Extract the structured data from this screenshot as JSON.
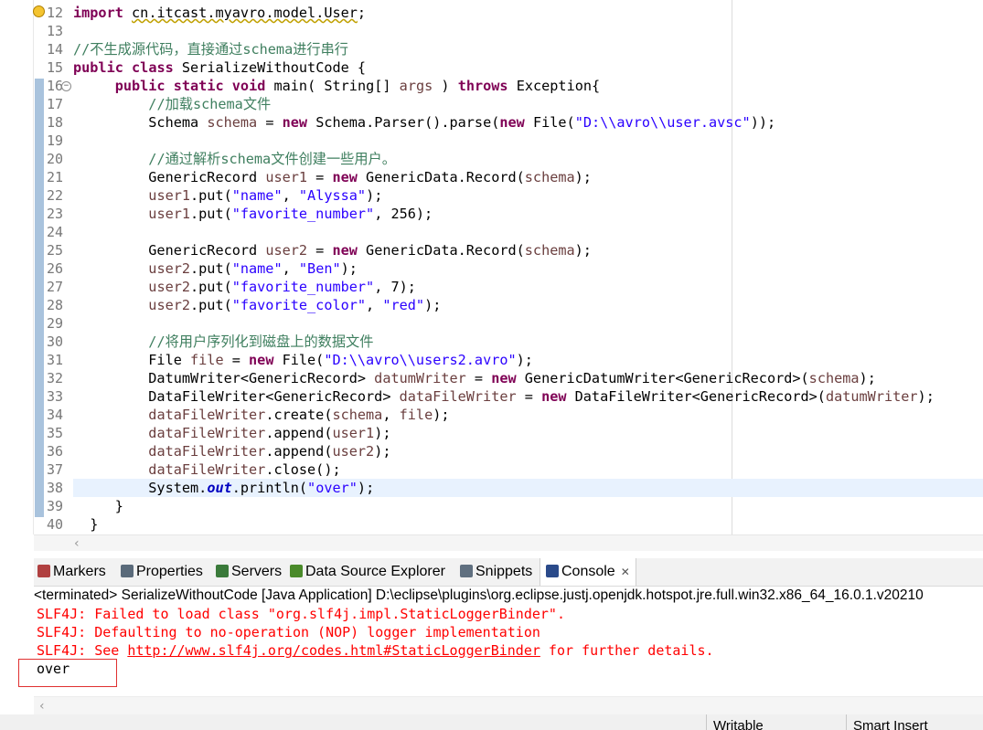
{
  "editor": {
    "lines": [
      {
        "n": "12",
        "parts": [
          {
            "t": "import",
            "c": "kw"
          },
          {
            "t": " "
          },
          {
            "t": "cn.itcast.myavro.model.User",
            "c": "imp"
          },
          {
            "t": ";"
          }
        ]
      },
      {
        "n": "13",
        "parts": []
      },
      {
        "n": "14",
        "parts": [
          {
            "t": "//不生成源代码，直接通过schema进行串行",
            "c": "cmt"
          }
        ]
      },
      {
        "n": "15",
        "parts": [
          {
            "t": "public",
            "c": "kw"
          },
          {
            "t": " "
          },
          {
            "t": "class",
            "c": "kw"
          },
          {
            "t": " SerializeWithoutCode {"
          }
        ]
      },
      {
        "n": "16",
        "parts": [
          {
            "t": "     "
          },
          {
            "t": "public",
            "c": "kw"
          },
          {
            "t": " "
          },
          {
            "t": "static",
            "c": "kw"
          },
          {
            "t": " "
          },
          {
            "t": "void",
            "c": "kw"
          },
          {
            "t": " main( String[] "
          },
          {
            "t": "args",
            "c": "var"
          },
          {
            "t": " ) "
          },
          {
            "t": "throws",
            "c": "kw"
          },
          {
            "t": " Exception{"
          }
        ]
      },
      {
        "n": "17",
        "parts": [
          {
            "t": "         "
          },
          {
            "t": "//加载schema文件",
            "c": "cmt"
          }
        ]
      },
      {
        "n": "18",
        "parts": [
          {
            "t": "         Schema "
          },
          {
            "t": "schema",
            "c": "var"
          },
          {
            "t": " = "
          },
          {
            "t": "new",
            "c": "kw"
          },
          {
            "t": " Schema.Parser().parse("
          },
          {
            "t": "new",
            "c": "kw"
          },
          {
            "t": " File("
          },
          {
            "t": "\"D:\\\\avro\\\\user.avsc\"",
            "c": "str"
          },
          {
            "t": "));"
          }
        ]
      },
      {
        "n": "19",
        "parts": []
      },
      {
        "n": "20",
        "parts": [
          {
            "t": "         "
          },
          {
            "t": "//通过解析schema文件创建一些用户。",
            "c": "cmt"
          }
        ]
      },
      {
        "n": "21",
        "parts": [
          {
            "t": "         GenericRecord "
          },
          {
            "t": "user1",
            "c": "var"
          },
          {
            "t": " = "
          },
          {
            "t": "new",
            "c": "kw"
          },
          {
            "t": " GenericData.Record("
          },
          {
            "t": "schema",
            "c": "var"
          },
          {
            "t": ");"
          }
        ]
      },
      {
        "n": "22",
        "parts": [
          {
            "t": "         "
          },
          {
            "t": "user1",
            "c": "var"
          },
          {
            "t": ".put("
          },
          {
            "t": "\"name\"",
            "c": "str"
          },
          {
            "t": ", "
          },
          {
            "t": "\"Alyssa\"",
            "c": "str"
          },
          {
            "t": ");"
          }
        ]
      },
      {
        "n": "23",
        "parts": [
          {
            "t": "         "
          },
          {
            "t": "user1",
            "c": "var"
          },
          {
            "t": ".put("
          },
          {
            "t": "\"favorite_number\"",
            "c": "str"
          },
          {
            "t": ", 256);"
          }
        ]
      },
      {
        "n": "24",
        "parts": []
      },
      {
        "n": "25",
        "parts": [
          {
            "t": "         GenericRecord "
          },
          {
            "t": "user2",
            "c": "var"
          },
          {
            "t": " = "
          },
          {
            "t": "new",
            "c": "kw"
          },
          {
            "t": " GenericData.Record("
          },
          {
            "t": "schema",
            "c": "var"
          },
          {
            "t": ");"
          }
        ]
      },
      {
        "n": "26",
        "parts": [
          {
            "t": "         "
          },
          {
            "t": "user2",
            "c": "var"
          },
          {
            "t": ".put("
          },
          {
            "t": "\"name\"",
            "c": "str"
          },
          {
            "t": ", "
          },
          {
            "t": "\"Ben\"",
            "c": "str"
          },
          {
            "t": ");"
          }
        ]
      },
      {
        "n": "27",
        "parts": [
          {
            "t": "         "
          },
          {
            "t": "user2",
            "c": "var"
          },
          {
            "t": ".put("
          },
          {
            "t": "\"favorite_number\"",
            "c": "str"
          },
          {
            "t": ", 7);"
          }
        ]
      },
      {
        "n": "28",
        "parts": [
          {
            "t": "         "
          },
          {
            "t": "user2",
            "c": "var"
          },
          {
            "t": ".put("
          },
          {
            "t": "\"favorite_color\"",
            "c": "str"
          },
          {
            "t": ", "
          },
          {
            "t": "\"red\"",
            "c": "str"
          },
          {
            "t": ");"
          }
        ]
      },
      {
        "n": "29",
        "parts": []
      },
      {
        "n": "30",
        "parts": [
          {
            "t": "         "
          },
          {
            "t": "//将用户序列化到磁盘上的数据文件",
            "c": "cmt"
          }
        ]
      },
      {
        "n": "31",
        "parts": [
          {
            "t": "         File "
          },
          {
            "t": "file",
            "c": "var"
          },
          {
            "t": " = "
          },
          {
            "t": "new",
            "c": "kw"
          },
          {
            "t": " File("
          },
          {
            "t": "\"D:\\\\avro\\\\users2.avro\"",
            "c": "str"
          },
          {
            "t": ");"
          }
        ]
      },
      {
        "n": "32",
        "parts": [
          {
            "t": "         DatumWriter<GenericRecord> "
          },
          {
            "t": "datumWriter",
            "c": "var"
          },
          {
            "t": " = "
          },
          {
            "t": "new",
            "c": "kw"
          },
          {
            "t": " GenericDatumWriter<GenericRecord>("
          },
          {
            "t": "schema",
            "c": "var"
          },
          {
            "t": ");"
          }
        ]
      },
      {
        "n": "33",
        "parts": [
          {
            "t": "         DataFileWriter<GenericRecord> "
          },
          {
            "t": "dataFileWriter",
            "c": "var"
          },
          {
            "t": " = "
          },
          {
            "t": "new",
            "c": "kw"
          },
          {
            "t": " DataFileWriter<GenericRecord>("
          },
          {
            "t": "datumWriter",
            "c": "var"
          },
          {
            "t": ");"
          }
        ]
      },
      {
        "n": "34",
        "parts": [
          {
            "t": "         "
          },
          {
            "t": "dataFileWriter",
            "c": "var"
          },
          {
            "t": ".create("
          },
          {
            "t": "schema",
            "c": "var"
          },
          {
            "t": ", "
          },
          {
            "t": "file",
            "c": "var"
          },
          {
            "t": ");"
          }
        ]
      },
      {
        "n": "35",
        "parts": [
          {
            "t": "         "
          },
          {
            "t": "dataFileWriter",
            "c": "var"
          },
          {
            "t": ".append("
          },
          {
            "t": "user1",
            "c": "var"
          },
          {
            "t": ");"
          }
        ]
      },
      {
        "n": "36",
        "parts": [
          {
            "t": "         "
          },
          {
            "t": "dataFileWriter",
            "c": "var"
          },
          {
            "t": ".append("
          },
          {
            "t": "user2",
            "c": "var"
          },
          {
            "t": ");"
          }
        ]
      },
      {
        "n": "37",
        "parts": [
          {
            "t": "         "
          },
          {
            "t": "dataFileWriter",
            "c": "var"
          },
          {
            "t": ".close();"
          }
        ]
      },
      {
        "n": "38",
        "current": true,
        "parts": [
          {
            "t": "         System."
          },
          {
            "t": "out",
            "c": "fld"
          },
          {
            "t": ".println("
          },
          {
            "t": "\"over\"",
            "c": "str"
          },
          {
            "t": ");"
          }
        ]
      },
      {
        "n": "39",
        "parts": [
          {
            "t": "     }"
          }
        ]
      },
      {
        "n": "40",
        "parts": [
          {
            "t": "  }"
          }
        ]
      }
    ]
  },
  "tabs": [
    {
      "label": "Markers",
      "icon": "markers-icon",
      "color": "#b04040"
    },
    {
      "label": "Properties",
      "icon": "properties-icon",
      "color": "#5a6a7a"
    },
    {
      "label": "Servers",
      "icon": "servers-icon",
      "color": "#3a7a3a"
    },
    {
      "label": "Data Source Explorer",
      "icon": "data-source-icon",
      "color": "#4a8a2a"
    },
    {
      "label": "Snippets",
      "icon": "snippets-icon",
      "color": "#607080"
    },
    {
      "label": "Console",
      "icon": "console-icon",
      "color": "#2a4a8a",
      "active": true
    }
  ],
  "console": {
    "header": "<terminated> SerializeWithoutCode [Java Application] D:\\eclipse\\plugins\\org.eclipse.justj.openjdk.hotspot.jre.full.win32.x86_64_16.0.1.v20210",
    "err1": "SLF4J: Failed to load class \"org.slf4j.impl.StaticLoggerBinder\".",
    "err2": "SLF4J: Defaulting to no-operation (NOP) logger implementation",
    "err3_prefix": "SLF4J: See ",
    "err3_link": "http://www.slf4j.org/codes.html#StaticLoggerBinder",
    "err3_suffix": " for further details.",
    "output": "over"
  },
  "status": {
    "writable": "Writable",
    "insert_mode": "Smart Insert"
  }
}
